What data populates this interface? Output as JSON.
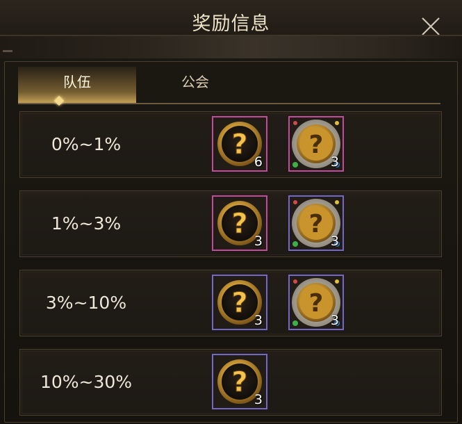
{
  "dialog": {
    "title": "奖励信息",
    "close_icon": "close-icon"
  },
  "tabs": [
    {
      "label": "队伍",
      "active": true
    },
    {
      "label": "公会",
      "active": false
    }
  ],
  "rows": [
    {
      "range": "0%~1%",
      "items": [
        {
          "icon": "mystery-chest-icon",
          "frame": "purple-pink",
          "count": "6"
        },
        {
          "icon": "mystery-gem-chest-icon",
          "frame": "purple-pink",
          "count": "3"
        }
      ]
    },
    {
      "range": "1%~3%",
      "items": [
        {
          "icon": "mystery-chest-icon",
          "frame": "purple-pink",
          "count": "3"
        },
        {
          "icon": "mystery-gem-chest-icon",
          "frame": "blue-purple",
          "count": "3"
        }
      ]
    },
    {
      "range": "3%~10%",
      "items": [
        {
          "icon": "mystery-chest-icon",
          "frame": "blue-purple",
          "count": "3"
        },
        {
          "icon": "mystery-gem-chest-icon",
          "frame": "blue-purple",
          "count": "3"
        }
      ]
    },
    {
      "range": "10%~30%",
      "items": [
        {
          "icon": "mystery-chest-icon",
          "frame": "blue-purple",
          "count": "3"
        }
      ]
    }
  ],
  "colors": {
    "pink_frame": "#c24b9b",
    "blue_frame": "#7367c8",
    "gold": "#d9a93a",
    "active_tab": "#c8a05a"
  }
}
